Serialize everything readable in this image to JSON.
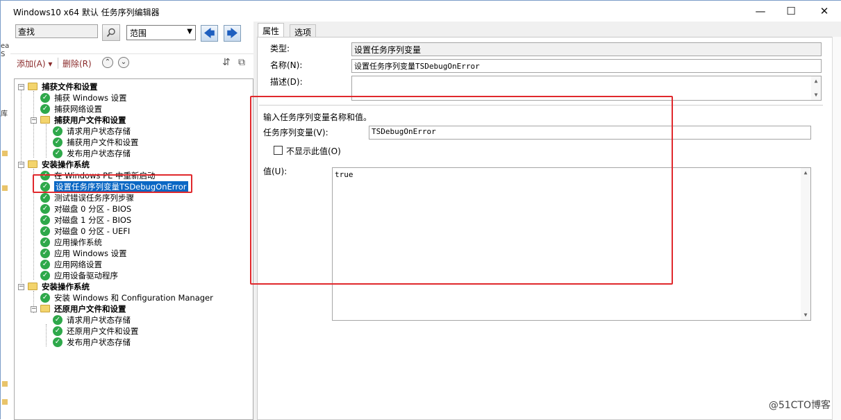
{
  "window": {
    "title": "Windows10 x64 默认 任务序列编辑器",
    "minimize": "—",
    "maximize": "☐",
    "close": "✕"
  },
  "edge": {
    "frag1": "ea",
    "frag2": "S",
    "frag3": "库"
  },
  "left": {
    "search_value": "查找",
    "search_icon": "magnifier-icon",
    "scope_value": "范围",
    "back_arrow": "🡄",
    "forward_arrow": "🡆",
    "add_label": "添加(A) ▾",
    "delete_label": "删除(R)",
    "move_up": "⌃",
    "move_down": "⌄",
    "tree": [
      {
        "label": "捕获文件和设置",
        "type": "group"
      },
      {
        "label": "捕获 Windows 设置",
        "type": "step"
      },
      {
        "label": "捕获网络设置",
        "type": "step"
      },
      {
        "label": "捕获用户文件和设置",
        "type": "group"
      },
      {
        "label": "请求用户状态存储",
        "type": "step"
      },
      {
        "label": "捕获用户文件和设置",
        "type": "step"
      },
      {
        "label": "发布用户状态存储",
        "type": "step"
      },
      {
        "label": "安装操作系统",
        "type": "group"
      },
      {
        "label": "在 Windows PE 中重新启动",
        "type": "step"
      },
      {
        "label": "设置任务序列变量TSDebugOnError",
        "type": "step",
        "selected": true
      },
      {
        "label": "测试错误任务序列步骤",
        "type": "step"
      },
      {
        "label": "对磁盘 0 分区 - BIOS",
        "type": "step"
      },
      {
        "label": "对磁盘 1 分区 - BIOS",
        "type": "step"
      },
      {
        "label": "对磁盘 0 分区 - UEFI",
        "type": "step"
      },
      {
        "label": "应用操作系统",
        "type": "step"
      },
      {
        "label": "应用 Windows 设置",
        "type": "step"
      },
      {
        "label": "应用网络设置",
        "type": "step"
      },
      {
        "label": "应用设备驱动程序",
        "type": "step"
      },
      {
        "label": "安装操作系统",
        "type": "group"
      },
      {
        "label": "安装 Windows 和 Configuration Manager",
        "type": "step"
      },
      {
        "label": "还原用户文件和设置",
        "type": "group"
      },
      {
        "label": "请求用户状态存储",
        "type": "step"
      },
      {
        "label": "还原用户文件和设置",
        "type": "step"
      },
      {
        "label": "发布用户状态存储",
        "type": "step"
      }
    ]
  },
  "right": {
    "tab_properties": "属性",
    "tab_options": "选项",
    "type_label": "类型:",
    "type_value": "设置任务序列变量",
    "name_label": "名称(N):",
    "name_value": "设置任务序列变量TSDebugOnError",
    "desc_label": "描述(D):",
    "desc_value": "",
    "instruction": "输入任务序列变量名称和值。",
    "variable_label": "任务序列变量(V):",
    "variable_value": "TSDebugOnError",
    "hide_value_label": "不显示此值(O)",
    "value_label": "值(U):",
    "value_text": "true"
  },
  "watermark": "@51CTO博客",
  "colors": {
    "selection": "#0a67c4",
    "annotation_red": "#e0282c",
    "check_green": "#2ea84a"
  }
}
